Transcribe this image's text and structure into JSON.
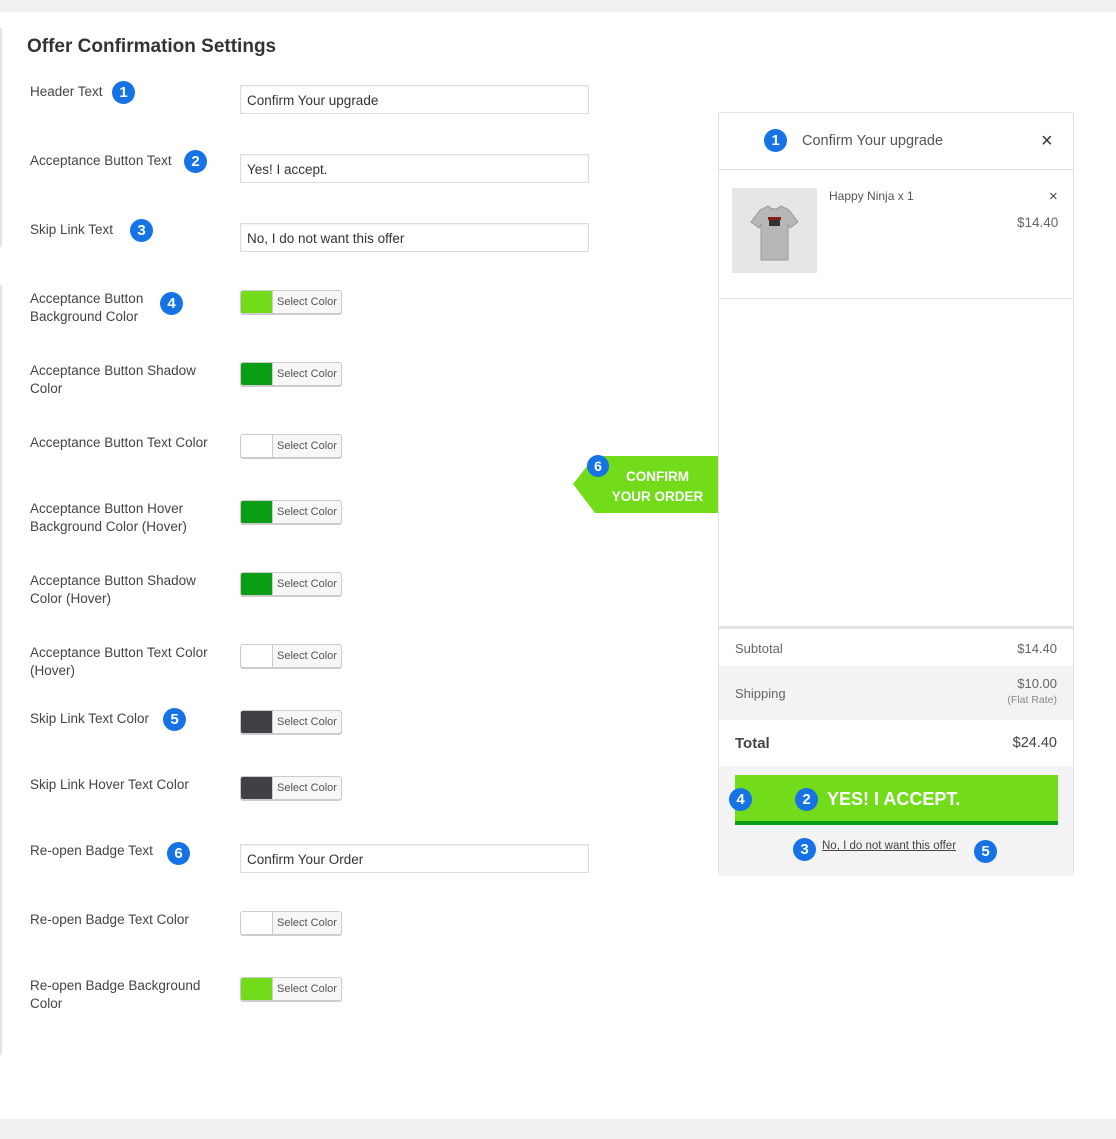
{
  "settings": {
    "title": "Offer Confirmation Settings",
    "select_color_label": "Select Color",
    "header_text": {
      "label": "Header Text",
      "badge": "1",
      "value": "Confirm Your upgrade"
    },
    "acceptance_button_text": {
      "label": "Acceptance Button Text",
      "badge": "2",
      "value": "Yes! I accept."
    },
    "skip_link_text": {
      "label": "Skip Link Text",
      "badge": "3",
      "value": "No, I do not want this offer"
    },
    "colors": [
      {
        "id": "accept-bg",
        "label": "Acceptance Button Background Color",
        "badge": "4",
        "color": "#72dc1a"
      },
      {
        "id": "accept-shadow",
        "label": "Acceptance Button Shadow Color",
        "badge": "",
        "color": "#0a9e15"
      },
      {
        "id": "accept-text",
        "label": "Acceptance Button Text Color",
        "badge": "",
        "color": "#ffffff"
      },
      {
        "id": "accept-hover-bg",
        "label": "Acceptance Button Hover Background Color  (Hover)",
        "badge": "",
        "color": "#0a9e15"
      },
      {
        "id": "accept-shadow-hover",
        "label": "Acceptance Button Shadow Color  (Hover)",
        "badge": "",
        "color": "#0a9e15"
      },
      {
        "id": "accept-text-hover",
        "label": "Acceptance Button Text Color (Hover)",
        "badge": "",
        "color": "#ffffff"
      },
      {
        "id": "skip-text",
        "label": "Skip Link Text Color",
        "badge": "5",
        "color": "#3f4147"
      },
      {
        "id": "skip-hover",
        "label": "Skip Link Hover Text Color",
        "badge": "",
        "color": "#3f4147"
      }
    ],
    "reopen_badge_text": {
      "label": "Re-open Badge Text",
      "badge": "6",
      "value": "Confirm Your Order"
    },
    "reopen_colors": [
      {
        "id": "reopen-text",
        "label": "Re-open Badge Text Color",
        "color": "#ffffff"
      },
      {
        "id": "reopen-bg",
        "label": "Re-open Badge Background Color",
        "color": "#72dc1a"
      }
    ]
  },
  "preview": {
    "badge_header": "1",
    "title": "Confirm Your upgrade",
    "close_icon": "×",
    "item": {
      "name": "Happy Ninja x 1",
      "remove_icon": "×",
      "price": "$14.40",
      "thumbnail_icon": "tshirt-icon"
    },
    "subtotal_label": "Subtotal",
    "subtotal_value": "$14.40",
    "shipping_label": "Shipping",
    "shipping_value": "$10.00",
    "shipping_note": "(Flat Rate)",
    "total_label": "Total",
    "total_value": "$24.40",
    "button_label": "YES! I ACCEPT.",
    "button_badge_left": "4",
    "button_badge": "2",
    "skip_link": "No, I do not want this offer",
    "skip_badge_left": "3",
    "skip_badge_right": "5",
    "reopen_badge_line1": "CONFIRM",
    "reopen_badge_line2": "YOUR ORDER",
    "reopen_badge_number": "6"
  },
  "colors": {
    "badge_blue": "#1673e6",
    "accent_green": "#72dc1a",
    "shadow_green": "#0a9e15"
  }
}
